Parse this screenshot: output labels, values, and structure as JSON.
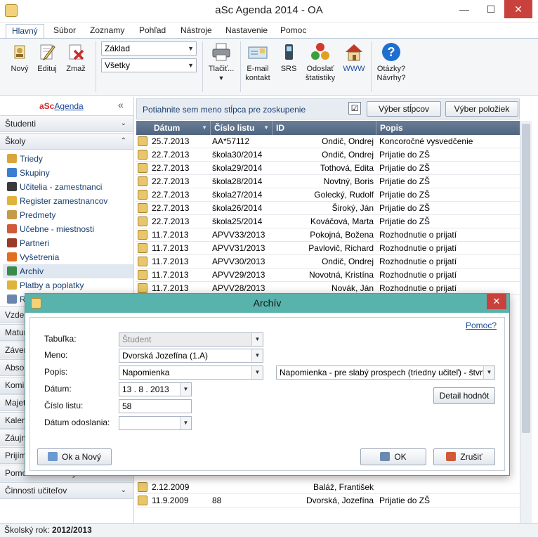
{
  "window": {
    "title": "aSc Agenda 2014 - OA",
    "minimize": "—",
    "maximize": "☐",
    "close": "✕"
  },
  "menu": [
    "Hlavný",
    "Súbor",
    "Zoznamy",
    "Pohľad",
    "Nástroje",
    "Nastavenie",
    "Pomoc"
  ],
  "ribbon": {
    "new": "Nový",
    "edit": "Edituj",
    "delete": "Zmaž",
    "filter1": "Základ",
    "filter2": "Všetky",
    "print": "Tlačiť...",
    "email": "E-mail kontakt",
    "srs": "SRS",
    "stats": "Odoslať štatistiky",
    "www": "WWW",
    "help": "Otázky? Návrhy?"
  },
  "sidebar": {
    "logo_asc": "aSc",
    "logo_agenda": "Agenda",
    "collapse": "«",
    "sections_top": [
      {
        "label": "Študenti",
        "chev": "¥"
      },
      {
        "label": "Školy",
        "chev": "«"
      }
    ],
    "items": [
      {
        "label": "Triedy",
        "color": "#d8a63c"
      },
      {
        "label": "Skupiny",
        "color": "#3a7fd0"
      },
      {
        "label": "Učitelia - zamestnanci",
        "color": "#3b3b3b"
      },
      {
        "label": "Register zamestnancov",
        "color": "#e0b43c"
      },
      {
        "label": "Predmety",
        "color": "#c79a4a"
      },
      {
        "label": "Učebne - miestnosti",
        "color": "#d05a3a"
      },
      {
        "label": "Partneri",
        "color": "#9a3a2a"
      },
      {
        "label": "Vyšetrenia",
        "color": "#e07020"
      },
      {
        "label": "Archív",
        "color": "#3a8a4a"
      },
      {
        "label": "Platby a poplatky",
        "color": "#e0b43c"
      },
      {
        "label": "Rozvrh",
        "color": "#6a86b0"
      }
    ],
    "sections_bottom": [
      {
        "label": "Vzdelávanie",
        "chev": "¥"
      },
      {
        "label": "Maturity",
        "chev": "¥"
      },
      {
        "label": "Záverečné skúšky",
        "chev": "¥"
      },
      {
        "label": "Absolventi",
        "chev": "¥"
      },
      {
        "label": "Komisie",
        "chev": "¥"
      },
      {
        "label": "Majetok",
        "chev": "¥"
      },
      {
        "label": "Kalendár",
        "chev": "¥"
      },
      {
        "label": "Záujmové útvary",
        "chev": "¥"
      },
      {
        "label": "Prijímacie konanie",
        "chev": "¥"
      },
      {
        "label": "Pomocné zoznamy",
        "chev": "¥"
      },
      {
        "label": "Činnosti učiteľov",
        "chev": "¥"
      }
    ]
  },
  "status": {
    "label": "Školský rok:",
    "value": "2012/2013"
  },
  "grid": {
    "hint": "Potiahnite sem meno stĺpca pre zoskupenie",
    "check": "☑",
    "btn_columns": "Výber stĺpcov",
    "btn_items": "Výber položiek",
    "columns": [
      "Dátum",
      "Číslo listu",
      "ID",
      "Popis"
    ],
    "rows": [
      [
        "25.7.2013",
        "AA*57112",
        "Ondič, Ondrej",
        "Koncoročné vysvedčenie"
      ],
      [
        "22.7.2013",
        "škola30/2014",
        "Ondič, Ondrej",
        "Prijatie do ZŠ"
      ],
      [
        "22.7.2013",
        "škola29/2014",
        "Tothová, Edita",
        "Prijatie do ZŠ"
      ],
      [
        "22.7.2013",
        "škola28/2014",
        "Novtný, Boris",
        "Prijatie do ZŠ"
      ],
      [
        "22.7.2013",
        "škola27/2014",
        "Golecký, Rudolf",
        "Prijatie do ZŠ"
      ],
      [
        "22.7.2013",
        "škola26/2014",
        "Široký, Ján",
        "Prijatie do ZŠ"
      ],
      [
        "22.7.2013",
        "škola25/2014",
        "Kováčová, Marta",
        "Prijatie do ZŠ"
      ],
      [
        "11.7.2013",
        "APVV33/2013",
        "Pokojná, Božena",
        "Rozhodnutie o prijatí"
      ],
      [
        "11.7.2013",
        "APVV31/2013",
        "Pavlovič, Richard",
        "Rozhodnutie o prijatí"
      ],
      [
        "11.7.2013",
        "APVV30/2013",
        "Ondič, Ondrej",
        "Rozhodnutie o prijatí"
      ],
      [
        "11.7.2013",
        "APVV29/2013",
        "Novotná, Kristína",
        "Rozhodnutie o prijatí"
      ],
      [
        "11.7.2013",
        "APVV28/2013",
        "Novák, Ján",
        "Rozhodnutie o prijatí"
      ]
    ],
    "bottom_rows": [
      [
        "2.12.2009",
        "",
        "Baláž, František",
        ""
      ],
      [
        "11.9.2009",
        "88",
        "Dvorská, Jozefína",
        "Prijatie do ZŠ"
      ]
    ]
  },
  "dialog": {
    "title": "Archív",
    "close": "✕",
    "help_link": "Pomoc?",
    "table_label": "Tabuľka:",
    "table_value": "Študent",
    "name_label": "Meno:",
    "name_value": "Dvorská Jozefína (1.A)",
    "desc_label": "Popis:",
    "desc_value": "Napomienka",
    "desc_detail": "Napomienka - pre slabý prospech (triedny učiteľ) - štvrťrok (ni",
    "date_label": "Dátum:",
    "date_value": "13 . 8 . 2013",
    "number_label": "Číslo listu:",
    "number_value": "58",
    "sent_label": "Dátum odoslania:",
    "sent_value": "",
    "detail_btn": "Detail hodnôt",
    "ok_new": "Ok a Nový",
    "ok": "OK",
    "cancel": "Zrušiť"
  }
}
